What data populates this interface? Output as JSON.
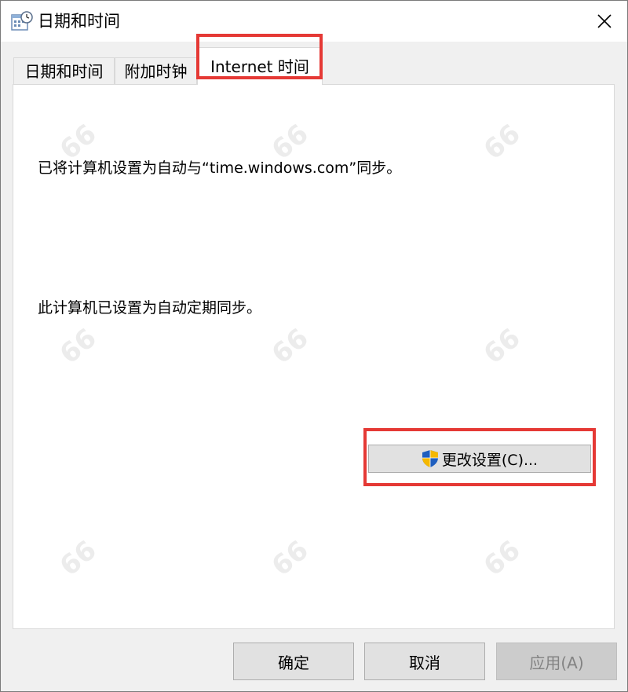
{
  "window": {
    "title": "日期和时间",
    "close_glyph": "✕"
  },
  "tabs": [
    {
      "label": "日期和时间"
    },
    {
      "label": "附加时钟"
    },
    {
      "label": "Internet 时间",
      "active": true
    }
  ],
  "panel": {
    "sync_status": "已将计算机设置为自动与“time.windows.com”同步。",
    "schedule_status": "此计算机已设置为自动定期同步。",
    "change_settings_label": "更改设置(C)..."
  },
  "footer": {
    "ok_label": "确定",
    "cancel_label": "取消",
    "apply_label": "应用(A)"
  },
  "watermark": "66",
  "colors": {
    "highlight": "#e53935",
    "panel_bg": "#ffffff",
    "window_bg": "#f0f0f0",
    "button_bg": "#e1e1e1",
    "disabled_text": "#838383"
  },
  "icons": {
    "title": "calendar-clock-icon",
    "close": "close-icon",
    "shield": "uac-shield-icon"
  }
}
